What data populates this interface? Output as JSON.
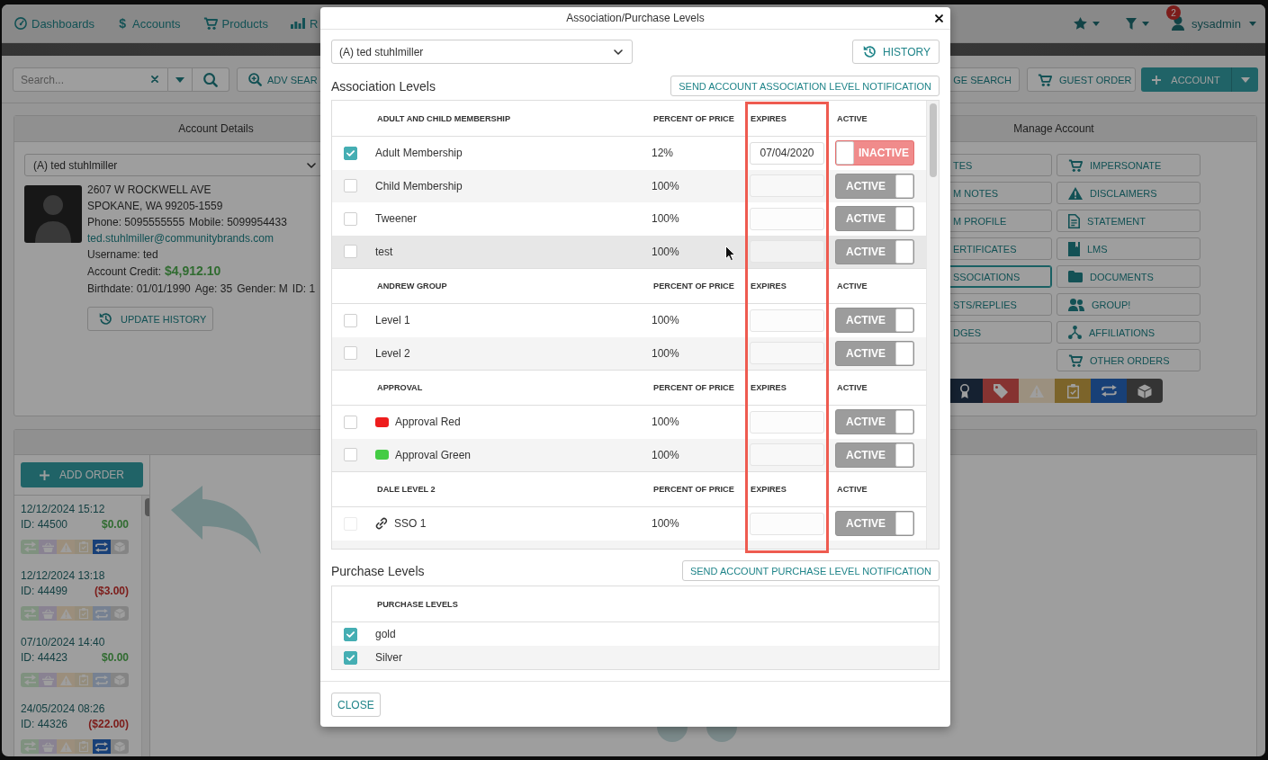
{
  "nav": {
    "items": [
      {
        "label": "Dashboards"
      },
      {
        "label": "Accounts",
        "symbol": "$"
      },
      {
        "label": "Products"
      },
      {
        "label": "R"
      }
    ],
    "badge": "2",
    "user": "sysadmin"
  },
  "toolbar": {
    "search": {
      "placeholder": "Search..."
    },
    "buttons": [
      {
        "kind": "outline",
        "label": "ADV SEAR"
      },
      {
        "kind": "outline",
        "label": "GE SEARCH"
      },
      {
        "kind": "outline",
        "label": "GUEST ORDER"
      },
      {
        "kind": "primary",
        "label": "ACCOUNT"
      }
    ]
  },
  "account_details": {
    "title": "Account Details",
    "account": "(A) ted stuhlmiller",
    "address": [
      "2607 W ROCKWELL AVE",
      "SPOKANE, WA 99205-1559"
    ],
    "contact": [
      "Phone: 5095555555",
      "Mobile: 5099954433"
    ],
    "email": "ted.stuhlmiller@communitybrands.com",
    "username": "Username: ted",
    "credit_label": "Account Credit:",
    "credit": "$4,912.10",
    "facts": [
      "Birthdate: 01/01/1990",
      "Age: 35",
      "Gender: M",
      "ID: 1"
    ],
    "update_button": "UPDATE HISTORY"
  },
  "manage_account": {
    "title": "Manage Account",
    "column_1": [
      {
        "label": "TES",
        "selected": false
      },
      {
        "label": "M NOTES",
        "selected": false
      },
      {
        "label": "M PROFILE",
        "selected": false
      },
      {
        "label": "ERTIFICATES",
        "selected": false
      },
      {
        "label": "SSOCIATIONS",
        "selected": true
      },
      {
        "label": "STS/REPLIES",
        "selected": false
      },
      {
        "label": "DGES",
        "selected": false
      }
    ],
    "column_2": [
      {
        "label": "IMPERSONATE",
        "selected": false
      },
      {
        "label": "DISCLAIMERS",
        "selected": false
      },
      {
        "label": "STATEMENT",
        "selected": false
      },
      {
        "label": "LMS",
        "selected": false
      },
      {
        "label": "DOCUMENTS",
        "selected": false
      },
      {
        "label": "GROUP!",
        "selected": false
      },
      {
        "label": "AFFILIATIONS",
        "selected": false
      },
      {
        "label": "OTHER ORDERS",
        "selected": false
      }
    ],
    "status_icons": [
      {
        "active": true
      },
      {
        "active": true
      },
      {
        "active": false
      },
      {
        "active": true
      },
      {
        "active": true
      },
      {
        "active": true
      }
    ]
  },
  "orders": {
    "add_button": "ADD ORDER",
    "items": [
      {
        "date": "12/12/2024 15:12",
        "id": "ID: 44500",
        "amount": "$0.00",
        "negative": false,
        "icons": [
          {
            "active": false
          },
          {
            "active": false
          },
          {
            "active": false
          },
          {
            "active": false
          },
          {
            "active": true
          },
          {
            "active": false
          }
        ]
      },
      {
        "date": "12/12/2024 13:18",
        "id": "ID: 44499",
        "amount": "($3.00)",
        "negative": true,
        "icons": [
          {
            "active": false
          },
          {
            "active": false
          },
          {
            "active": false
          },
          {
            "active": false
          },
          {
            "active": false
          },
          {
            "active": false
          }
        ]
      },
      {
        "date": "07/10/2024 14:40",
        "id": "ID: 44423",
        "amount": "$0.00",
        "negative": false,
        "icons": [
          {
            "active": false
          },
          {
            "active": false
          },
          {
            "active": false
          },
          {
            "active": false
          },
          {
            "active": false
          },
          {
            "active": false
          }
        ]
      },
      {
        "date": "24/05/2024 08:26",
        "id": "ID: 44326",
        "amount": "($22.00)",
        "negative": true,
        "icons": [
          {
            "active": false
          },
          {
            "active": false
          },
          {
            "active": false
          },
          {
            "active": false
          },
          {
            "active": true
          },
          {
            "active": false
          }
        ]
      }
    ]
  },
  "modal": {
    "title": "Association/Purchase Levels",
    "account": "(A) ted stuhlmiller",
    "history_button": "HISTORY",
    "association": {
      "heading": "Association Levels",
      "notify_button": "SEND ACCOUNT ASSOCIATION LEVEL NOTIFICATION",
      "groups": [
        {
          "title": "ADULT AND CHILD MEMBERSHIP",
          "columns": [
            "PERCENT OF PRICE",
            "EXPIRES",
            "ACTIVE"
          ],
          "rows": [
            {
              "kind": "plain",
              "name": "Adult Membership",
              "percent": "12%",
              "checked": true,
              "checkbox_disabled": false,
              "hovered": false,
              "editable": true,
              "expires": "07/04/2020",
              "active": false,
              "toggle_label": "INACTIVE"
            },
            {
              "kind": "plain",
              "name": "Child Membership",
              "percent": "100%",
              "checked": false,
              "checkbox_disabled": false,
              "hovered": false,
              "editable": false,
              "active": true,
              "toggle_label": "ACTIVE"
            },
            {
              "kind": "plain",
              "name": "Tweener",
              "percent": "100%",
              "checked": false,
              "checkbox_disabled": false,
              "hovered": false,
              "editable": false,
              "active": true,
              "toggle_label": "ACTIVE"
            },
            {
              "kind": "plain",
              "name": "test",
              "percent": "100%",
              "checked": false,
              "checkbox_disabled": false,
              "hovered": true,
              "editable": false,
              "active": true,
              "toggle_label": "ACTIVE"
            }
          ]
        },
        {
          "title": "ANDREW GROUP",
          "columns": [
            "PERCENT OF PRICE",
            "EXPIRES",
            "ACTIVE"
          ],
          "rows": [
            {
              "kind": "plain",
              "name": "Level 1",
              "percent": "100%",
              "checked": false,
              "checkbox_disabled": false,
              "hovered": false,
              "editable": false,
              "active": true,
              "toggle_label": "ACTIVE"
            },
            {
              "kind": "plain",
              "name": "Level 2",
              "percent": "100%",
              "checked": false,
              "checkbox_disabled": false,
              "hovered": false,
              "editable": false,
              "active": true,
              "toggle_label": "ACTIVE"
            }
          ]
        },
        {
          "title": "APPROVAL",
          "columns": [
            "PERCENT OF PRICE",
            "EXPIRES",
            "ACTIVE"
          ],
          "rows": [
            {
              "kind": "swatch",
              "color": "#ee1d1d",
              "name": "Approval Red",
              "percent": "100%",
              "checked": false,
              "checkbox_disabled": false,
              "hovered": false,
              "editable": false,
              "active": true,
              "toggle_label": "ACTIVE"
            },
            {
              "kind": "swatch",
              "color": "#44cc44",
              "name": "Approval Green",
              "percent": "100%",
              "checked": false,
              "checkbox_disabled": false,
              "hovered": false,
              "editable": false,
              "active": true,
              "toggle_label": "ACTIVE"
            }
          ]
        },
        {
          "title": "DALE LEVEL 2",
          "columns": [
            "PERCENT OF PRICE",
            "EXPIRES",
            "ACTIVE"
          ],
          "rows": [
            {
              "kind": "link",
              "name": "SSO 1",
              "percent": "100%",
              "checked": false,
              "checkbox_disabled": true,
              "hovered": false,
              "editable": false,
              "active": true,
              "toggle_label": "ACTIVE"
            }
          ]
        }
      ]
    },
    "purchase": {
      "heading": "Purchase Levels",
      "notify_button": "SEND ACCOUNT PURCHASE LEVEL NOTIFICATION",
      "column": "PURCHASE LEVELS",
      "rows": [
        {
          "name": "gold",
          "checked": true
        },
        {
          "name": "Silver",
          "checked": true
        }
      ]
    },
    "close_button": "CLOSE"
  }
}
